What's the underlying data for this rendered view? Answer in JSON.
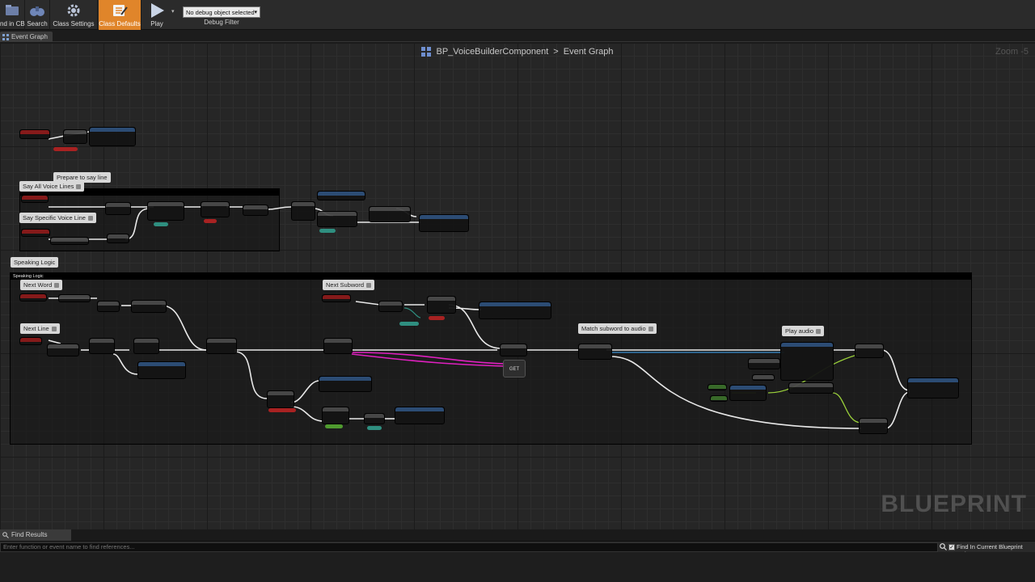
{
  "toolbar": {
    "buttons": [
      {
        "label": "Find in CB",
        "icon": "find-in-cb-icon"
      },
      {
        "label": "Search",
        "icon": "binoculars-icon"
      },
      {
        "label": "Class Settings",
        "icon": "gear-icon"
      },
      {
        "label": "Class Defaults",
        "icon": "class-defaults-icon",
        "active": true
      },
      {
        "label": "Play",
        "icon": "play-icon"
      }
    ],
    "debug_select_value": "No debug object selected",
    "debug_filter_label": "Debug Filter"
  },
  "tab": {
    "label": "Event Graph"
  },
  "graph": {
    "breadcrumb_blueprint": "BP_VoiceBuilderComponent",
    "breadcrumb_separator": ">",
    "breadcrumb_graph": "Event Graph",
    "zoom": "Zoom -5",
    "watermark": "BLUEPRINT"
  },
  "comments": {
    "prepare": "Prepare to say line",
    "say_all": "Say All Voice Lines",
    "say_specific": "Say Specific Voice Line",
    "speaking_logic": "Speaking Logic",
    "speaking_logic_header": "Speaking Logic",
    "next_word": "Next Word",
    "next_line": "Next Line",
    "next_subword": "Next Subword",
    "match_subword": "Match subword to audio",
    "play_audio": "Play audio",
    "get_node": "GET"
  },
  "find": {
    "tab_label": "Find Results",
    "placeholder": "Enter function or event name to find references...",
    "checkbox_label": "Find In Current Blueprint Only",
    "checkbox_checked": true
  },
  "colors": {
    "exec_wire": "#e8e8e8",
    "pink_wire": "#e020c0",
    "blue_wire": "#3a8fd0",
    "green_wire": "#9ad03a",
    "active_button": "#e0852a"
  }
}
